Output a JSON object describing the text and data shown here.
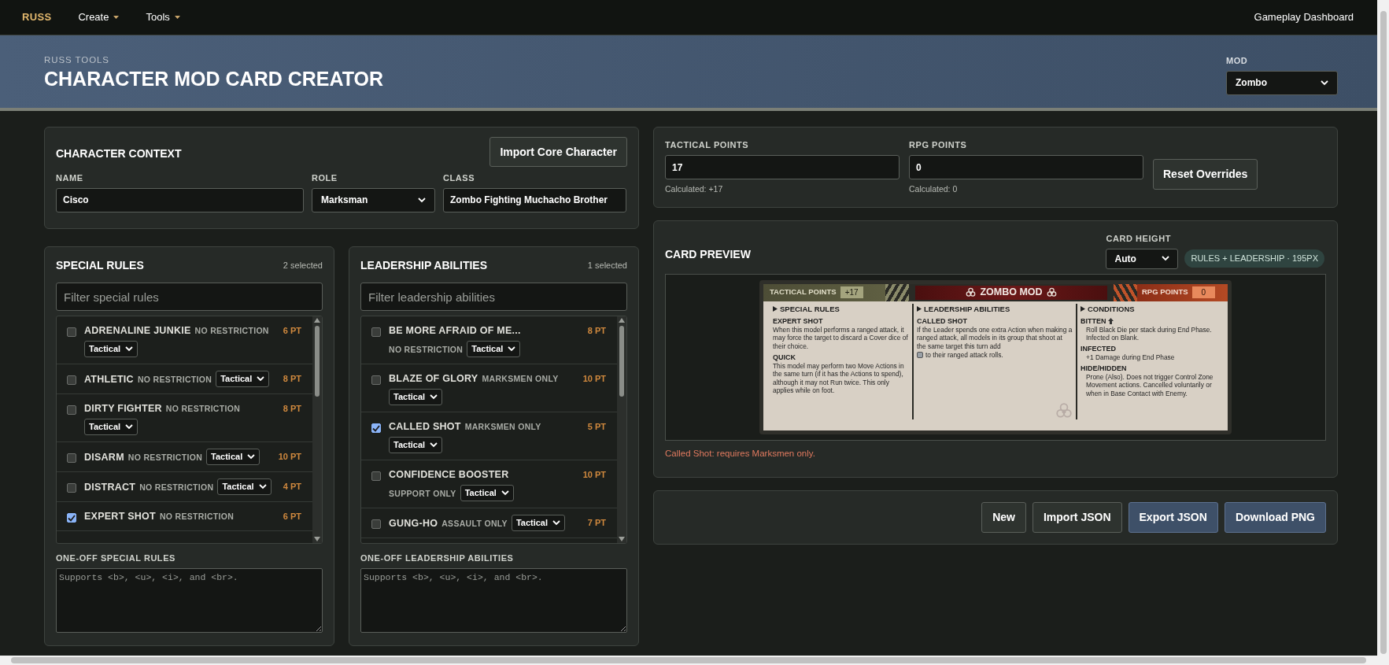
{
  "nav": {
    "brand": "RUSS",
    "menus": [
      {
        "label": "Create"
      },
      {
        "label": "Tools"
      }
    ],
    "right_link": "Gameplay Dashboard"
  },
  "header": {
    "eyebrow": "RUSS TOOLS",
    "title": "CHARACTER MOD CARD CREATOR",
    "mod": {
      "label": "MOD",
      "value": "Zombo"
    }
  },
  "character_context": {
    "title": "CHARACTER CONTEXT",
    "import_button": "Import Core Character",
    "fields": [
      {
        "label": "NAME",
        "value": "Cisco",
        "kind": "text"
      },
      {
        "label": "ROLE",
        "value": "Marksman",
        "kind": "select"
      },
      {
        "label": "CLASS",
        "value": "Zombo Fighting Muchacho Brother",
        "kind": "text"
      }
    ]
  },
  "special_rules": {
    "title": "SPECIAL RULES",
    "count": "2 selected",
    "filter_placeholder": "Filter special rules",
    "items": [
      {
        "name": "ADRENALINE JUNKIE",
        "restriction": "NO RESTRICTION",
        "type": "Tactical",
        "points": "6 PT",
        "checked": false
      },
      {
        "name": "ATHLETIC",
        "restriction": "NO RESTRICTION",
        "type": "Tactical",
        "points": "8 PT",
        "checked": false
      },
      {
        "name": "DIRTY FIGHTER",
        "restriction": "NO RESTRICTION",
        "type": "Tactical",
        "points": "8 PT",
        "checked": false
      },
      {
        "name": "DISARM",
        "restriction": "NO RESTRICTION",
        "type": "Tactical",
        "points": "10 PT",
        "checked": false
      },
      {
        "name": "DISTRACT",
        "restriction": "NO RESTRICTION",
        "type": "Tactical",
        "points": "4 PT",
        "checked": false
      },
      {
        "name": "EXPERT SHOT",
        "restriction": "NO RESTRICTION",
        "points": "6 PT",
        "checked": true
      }
    ],
    "one_off": {
      "label": "ONE-OFF SPECIAL RULES",
      "placeholder": "Supports <b>, <u>, <i>, and <br>."
    }
  },
  "leadership_abilities": {
    "title": "LEADERSHIP ABILITIES",
    "count": "1 selected",
    "filter_placeholder": "Filter leadership abilities",
    "items": [
      {
        "name": "BE MORE AFRAID OF ME...",
        "restriction": "NO RESTRICTION",
        "type": "Tactical",
        "points": "8 PT",
        "checked": false
      },
      {
        "name": "BLAZE OF GLORY",
        "restriction": "MARKSMEN ONLY",
        "type": "Tactical",
        "points": "10 PT",
        "checked": false
      },
      {
        "name": "CALLED SHOT",
        "restriction": "MARKSMEN ONLY",
        "type": "Tactical",
        "points": "5 PT",
        "checked": true
      },
      {
        "name": "CONFIDENCE BOOSTER",
        "restriction": "SUPPORT ONLY",
        "type": "Tactical",
        "points": "10 PT",
        "checked": false
      },
      {
        "name": "GUNG-HO",
        "restriction": "ASSAULT ONLY",
        "type": "Tactical",
        "points": "7 PT",
        "checked": false
      }
    ],
    "one_off": {
      "label": "ONE-OFF LEADERSHIP ABILITIES",
      "placeholder": "Supports <b>, <u>, <i>, and <br>."
    }
  },
  "points": {
    "tactical": {
      "label": "TACTICAL POINTS",
      "value": "17",
      "calculated": "Calculated: +17"
    },
    "rpg": {
      "label": "RPG POINTS",
      "value": "0",
      "calculated": "Calculated: 0"
    },
    "reset_button": "Reset Overrides"
  },
  "card_preview": {
    "title": "CARD PREVIEW",
    "height": {
      "label": "CARD HEIGHT",
      "value": "Auto"
    },
    "badge": "RULES + LEADERSHIP · 195PX",
    "card": {
      "tactical_label": "TACTICAL POINTS",
      "tactical_value": "+17",
      "title": "ZOMBO MOD",
      "rpg_label": "RPG POINTS",
      "rpg_value": "0",
      "columns": [
        {
          "heading": "SPECIAL RULES",
          "entries": [
            {
              "name": "EXPERT SHOT",
              "kind": "plain",
              "text": "When this model performs a ranged attack, it may force the target to discard a Cover dice of their choice."
            },
            {
              "name": "QUICK",
              "kind": "plain",
              "text": "This model may perform two Move Actions in the same turn (if it has the Actions to spend), although it may not Run twice. This only applies while on foot."
            }
          ]
        },
        {
          "heading": "LEADERSHIP ABILITIES",
          "entries": [
            {
              "name": "CALLED SHOT",
              "kind": "inline_die",
              "text": "If the Leader spends one extra Action when making a ranged attack, all models in its group that shoot at the same target this turn add",
              "text_after_icon": "to their ranged attack rolls."
            }
          ]
        },
        {
          "heading": "CONDITIONS",
          "entries": [
            {
              "name": "BITTEN",
              "kind": "arrow_icon",
              "text": "Roll Black Die per stack during End Phase. Infected on Blank."
            },
            {
              "name": "INFECTED",
              "kind": "plain",
              "text": "+1 Damage during End Phase"
            },
            {
              "name": "HIDE/HIDDEN",
              "kind": "plain",
              "text": "Prone (Also). Does not trigger Control Zone Movement actions. Cancelled voluntarily or when in Base Contact with Enemy."
            }
          ]
        }
      ]
    },
    "warning": "Called Shot: requires Marksmen only."
  },
  "actions": [
    {
      "label": "New",
      "kind": "plain"
    },
    {
      "label": "Import JSON",
      "kind": "plain"
    },
    {
      "label": "Export JSON",
      "kind": "primary"
    },
    {
      "label": "Download PNG",
      "kind": "primary"
    }
  ]
}
